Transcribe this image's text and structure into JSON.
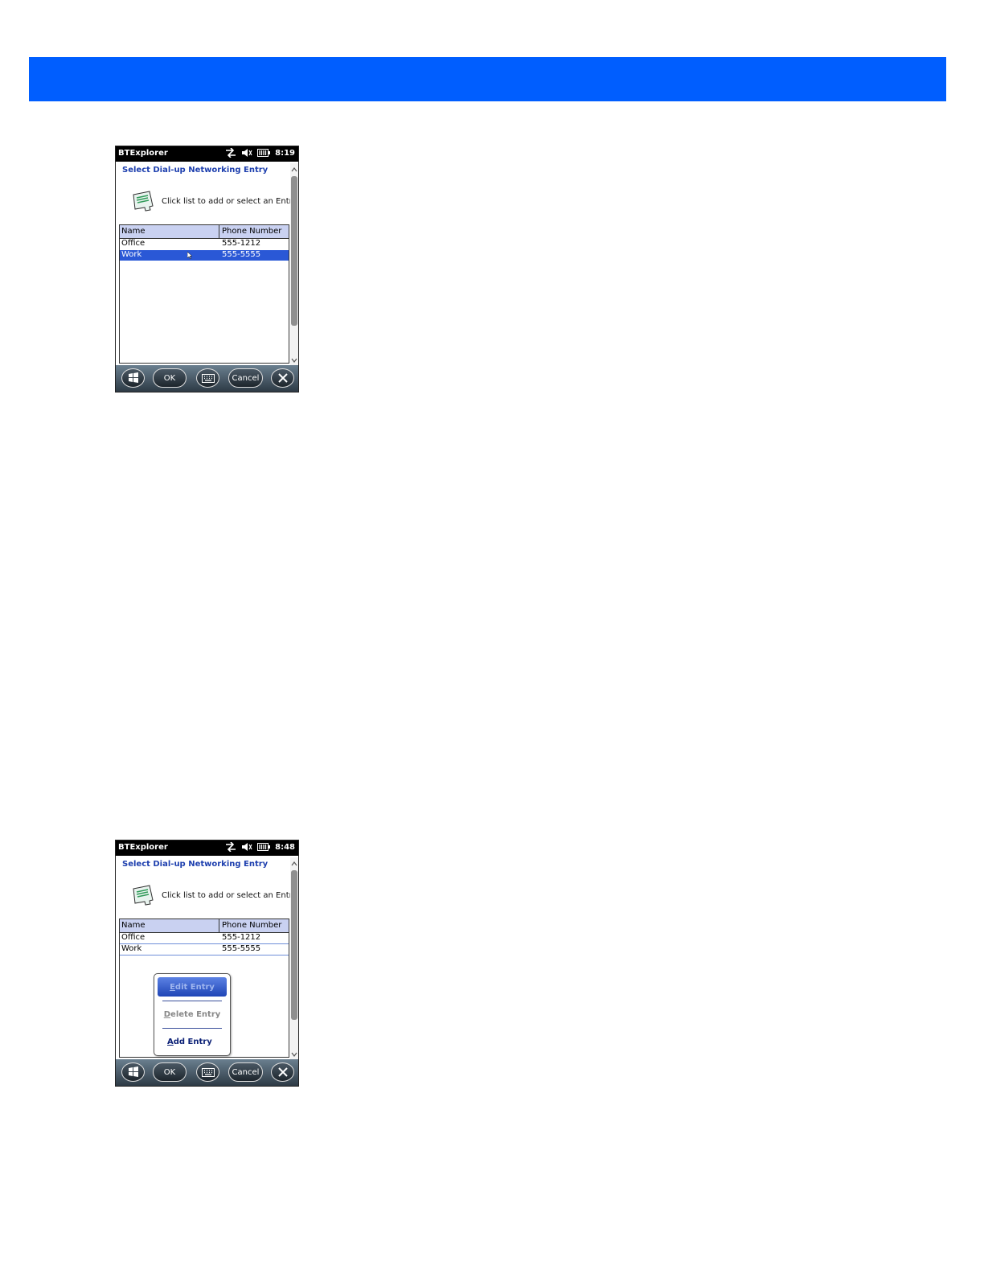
{
  "screens": [
    {
      "app_title": "BTExplorer",
      "clock": "8:19",
      "heading": "Select Dial-up Networking Entry",
      "hint": "Click list to add or select an Entry.",
      "columns": [
        "Name",
        "Phone Number"
      ],
      "rows": [
        {
          "name": "Office",
          "phone": "555-1212"
        },
        {
          "name": "Work",
          "phone": "555-5555"
        }
      ],
      "selected_row": "Work",
      "softkeys": {
        "ok": "OK",
        "cancel": "Cancel"
      }
    },
    {
      "app_title": "BTExplorer",
      "clock": "8:48",
      "heading": "Select Dial-up Networking Entry",
      "hint": "Click list to add or select an Entry.",
      "columns": [
        "Name",
        "Phone Number"
      ],
      "rows": [
        {
          "name": "Office",
          "phone": "555-1212"
        },
        {
          "name": "Work",
          "phone": "555-5555"
        }
      ],
      "softkeys": {
        "ok": "OK",
        "cancel": "Cancel"
      },
      "context_menu": {
        "edit": {
          "mnemonic": "E",
          "rest": "dit Entry"
        },
        "delete": {
          "mnemonic": "D",
          "rest": "elete Entry"
        },
        "add": {
          "mnemonic": "A",
          "rest": "dd Entry"
        }
      }
    }
  ],
  "colors": {
    "banner": "#005eff",
    "heading": "#1d3fae",
    "selection": "#2a58d6",
    "list_header": "#c9d1f1"
  },
  "icons": [
    "windows-start-icon",
    "keyboard-icon",
    "close-icon",
    "sync-arrows-icon",
    "speaker-muted-icon",
    "battery-icon",
    "dialup-entry-icon",
    "pointer-cursor-icon"
  ]
}
